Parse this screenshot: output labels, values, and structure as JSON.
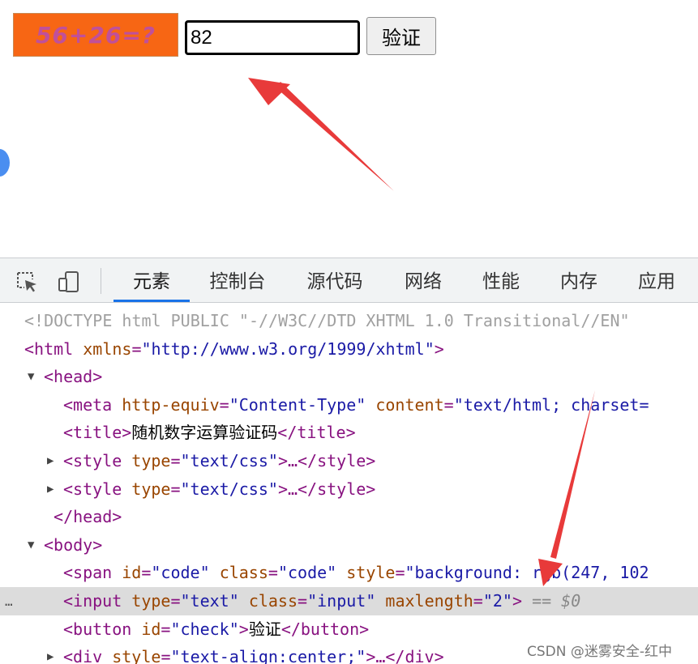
{
  "page": {
    "captcha_text": "56+26=?",
    "input_value": "82",
    "check_button": "验证"
  },
  "devtools": {
    "tabs": [
      "元素",
      "控制台",
      "源代码",
      "网络",
      "性能",
      "内存",
      "应用"
    ],
    "active_tab": "元素",
    "icons": [
      "inspect-element-icon",
      "device-toolbar-icon"
    ],
    "lines": [
      {
        "indent": 0,
        "tri": "",
        "parts": [
          {
            "c": "doctype",
            "t": "<!DOCTYPE html PUBLIC \"-//W3C//DTD XHTML 1.0 Transitional//EN\""
          }
        ]
      },
      {
        "indent": 0,
        "tri": "",
        "parts": [
          {
            "c": "tag",
            "t": "<html "
          },
          {
            "c": "attr",
            "t": "xmlns"
          },
          {
            "c": "tag",
            "t": "="
          },
          {
            "c": "val",
            "t": "\"http://www.w3.org/1999/xhtml\""
          },
          {
            "c": "tag",
            "t": ">"
          }
        ]
      },
      {
        "indent": 1,
        "tri": "▼",
        "parts": [
          {
            "c": "tag",
            "t": "<head>"
          }
        ]
      },
      {
        "indent": 2,
        "tri": "",
        "parts": [
          {
            "c": "tag",
            "t": "<meta "
          },
          {
            "c": "attr",
            "t": "http-equiv"
          },
          {
            "c": "tag",
            "t": "="
          },
          {
            "c": "val",
            "t": "\"Content-Type\""
          },
          {
            "c": "tag",
            "t": " "
          },
          {
            "c": "attr",
            "t": "content"
          },
          {
            "c": "tag",
            "t": "="
          },
          {
            "c": "val",
            "t": "\"text/html; charset="
          }
        ]
      },
      {
        "indent": 2,
        "tri": "",
        "parts": [
          {
            "c": "tag",
            "t": "<title>"
          },
          {
            "c": "txt",
            "t": "随机数字运算验证码"
          },
          {
            "c": "tag",
            "t": "</title>"
          }
        ]
      },
      {
        "indent": 2,
        "tri": "▶",
        "parts": [
          {
            "c": "tag",
            "t": "<style "
          },
          {
            "c": "attr",
            "t": "type"
          },
          {
            "c": "tag",
            "t": "="
          },
          {
            "c": "val",
            "t": "\"text/css\""
          },
          {
            "c": "tag",
            "t": ">…</style>"
          }
        ]
      },
      {
        "indent": 2,
        "tri": "▶",
        "parts": [
          {
            "c": "tag",
            "t": "<style "
          },
          {
            "c": "attr",
            "t": "type"
          },
          {
            "c": "tag",
            "t": "="
          },
          {
            "c": "val",
            "t": "\"text/css\""
          },
          {
            "c": "tag",
            "t": ">…</style>"
          }
        ]
      },
      {
        "indent": 1,
        "tri": "",
        "parts": [
          {
            "c": "tag",
            "t": " </head>"
          }
        ]
      },
      {
        "indent": 1,
        "tri": "▼",
        "parts": [
          {
            "c": "tag",
            "t": "<body>"
          }
        ]
      },
      {
        "indent": 2,
        "tri": "",
        "parts": [
          {
            "c": "tag",
            "t": "<span "
          },
          {
            "c": "attr",
            "t": "id"
          },
          {
            "c": "tag",
            "t": "="
          },
          {
            "c": "val",
            "t": "\"code\""
          },
          {
            "c": "tag",
            "t": " "
          },
          {
            "c": "attr",
            "t": "class"
          },
          {
            "c": "tag",
            "t": "="
          },
          {
            "c": "val",
            "t": "\"code\""
          },
          {
            "c": "tag",
            "t": " "
          },
          {
            "c": "attr",
            "t": "style"
          },
          {
            "c": "tag",
            "t": "="
          },
          {
            "c": "val",
            "t": "\"background: rgb(247, 102"
          }
        ]
      },
      {
        "indent": 2,
        "tri": "",
        "selected": true,
        "parts": [
          {
            "c": "tag",
            "t": "<input "
          },
          {
            "c": "attr",
            "t": "type"
          },
          {
            "c": "tag",
            "t": "="
          },
          {
            "c": "val",
            "t": "\"text\""
          },
          {
            "c": "tag",
            "t": " "
          },
          {
            "c": "attr",
            "t": "class"
          },
          {
            "c": "tag",
            "t": "="
          },
          {
            "c": "val",
            "t": "\"input\""
          },
          {
            "c": "tag",
            "t": " "
          },
          {
            "c": "attr",
            "t": "maxlength"
          },
          {
            "c": "tag",
            "t": "="
          },
          {
            "c": "val",
            "t": "\"2\""
          },
          {
            "c": "tag",
            "t": "> "
          },
          {
            "c": "eq0",
            "t": "== $0"
          }
        ]
      },
      {
        "indent": 2,
        "tri": "",
        "parts": [
          {
            "c": "tag",
            "t": "<button "
          },
          {
            "c": "attr",
            "t": "id"
          },
          {
            "c": "tag",
            "t": "="
          },
          {
            "c": "val",
            "t": "\"check\""
          },
          {
            "c": "tag",
            "t": ">"
          },
          {
            "c": "txt",
            "t": "验证"
          },
          {
            "c": "tag",
            "t": "</button>"
          }
        ]
      },
      {
        "indent": 2,
        "tri": "▶",
        "parts": [
          {
            "c": "tag",
            "t": "<div "
          },
          {
            "c": "attr",
            "t": "style"
          },
          {
            "c": "tag",
            "t": "="
          },
          {
            "c": "val",
            "t": "\"text-align:center;\""
          },
          {
            "c": "tag",
            "t": ">…</div>"
          }
        ]
      }
    ],
    "selected_marker": "…"
  },
  "watermark": "CSDN @迷雾安全-红中",
  "colors": {
    "captcha_bg": "#f76614",
    "captcha_text": "#c0509a",
    "active_tab_underline": "#1a73e8",
    "annotation_arrow": "#e83a3a"
  }
}
